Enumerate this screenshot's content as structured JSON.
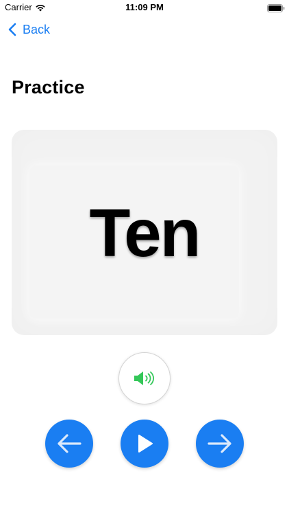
{
  "status_bar": {
    "carrier": "Carrier",
    "time": "11:09 PM",
    "icons": [
      "wifi-icon",
      "battery-icon"
    ]
  },
  "nav": {
    "back_label": "Back",
    "back_icon": "chevron-left-icon"
  },
  "page": {
    "title": "Practice"
  },
  "card": {
    "word": "Ten"
  },
  "controls": {
    "speak_icon": "speaker-icon",
    "prev_icon": "arrow-left-icon",
    "play_icon": "play-icon",
    "next_icon": "arrow-right-icon"
  },
  "colors": {
    "accent": "#1a7ef2",
    "speaker": "#34c759",
    "card_background": "#f2f2f2"
  }
}
